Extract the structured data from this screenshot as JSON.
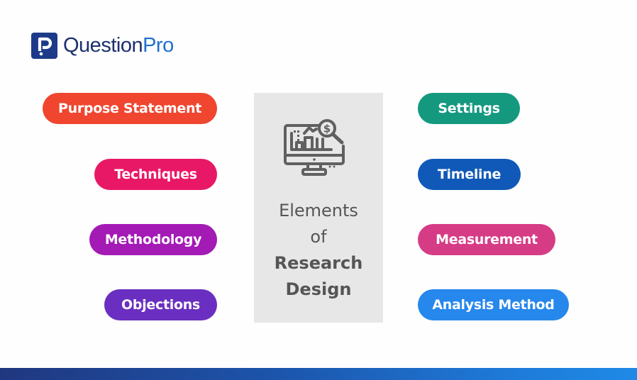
{
  "brand": {
    "name_part1": "Question",
    "name_part2": "Pro",
    "logo_color": "#1d3a8a",
    "text_color_dark": "#1d2f6f",
    "text_color_accent": "#1f6fd0"
  },
  "center": {
    "icon": "monitor-chart-dollar-magnifier-icon",
    "line1": "Elements",
    "line2": "of",
    "line3": "Research",
    "line4": "Design",
    "background": "#e7e7e7"
  },
  "left_items": [
    {
      "label": "Purpose Statement",
      "color": "#f0452e"
    },
    {
      "label": "Techniques",
      "color": "#e91866"
    },
    {
      "label": "Methodology",
      "color": "#a31ab5"
    },
    {
      "label": "Objections",
      "color": "#6a2fc0"
    }
  ],
  "right_items": [
    {
      "label": "Settings",
      "color": "#14997f"
    },
    {
      "label": "Timeline",
      "color": "#1159b8"
    },
    {
      "label": "Measurement",
      "color": "#d63c86"
    },
    {
      "label": "Analysis Method",
      "color": "#2687ec"
    }
  ],
  "footer_gradient": [
    "#20377f",
    "#1f8ae6"
  ]
}
